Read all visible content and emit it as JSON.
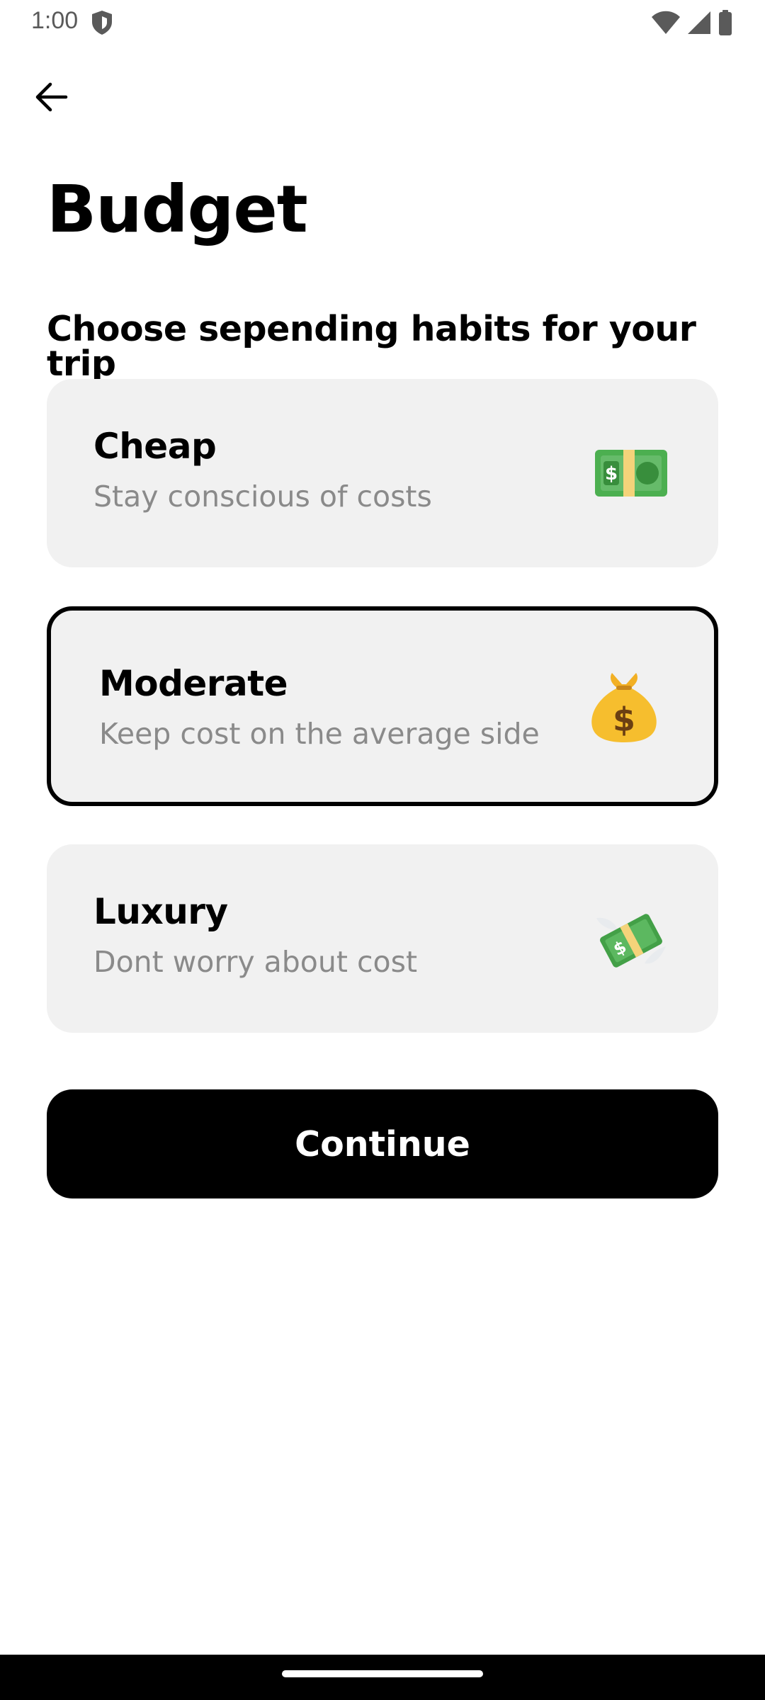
{
  "status_bar": {
    "time": "1:00",
    "icons": [
      "shield-icon",
      "wifi-icon",
      "signal-icon",
      "battery-icon"
    ]
  },
  "header": {
    "back_icon": "arrow-left-icon",
    "title": "Budget"
  },
  "section": {
    "subtitle": "Choose sepending habits for your trip"
  },
  "options": [
    {
      "title": "Cheap",
      "description": "Stay conscious of costs",
      "icon": "dollar-banknote-icon",
      "selected": false
    },
    {
      "title": "Moderate",
      "description": "Keep cost on the average side",
      "icon": "money-bag-icon",
      "selected": true
    },
    {
      "title": "Luxury",
      "description": "Dont worry about cost",
      "icon": "money-with-wings-icon",
      "selected": false
    }
  ],
  "actions": {
    "continue_label": "Continue"
  },
  "colors": {
    "card_background": "#f1f1f1",
    "selected_border": "#000000",
    "button_background": "#000000",
    "button_text": "#ffffff",
    "description_text": "#8a8a8a"
  }
}
